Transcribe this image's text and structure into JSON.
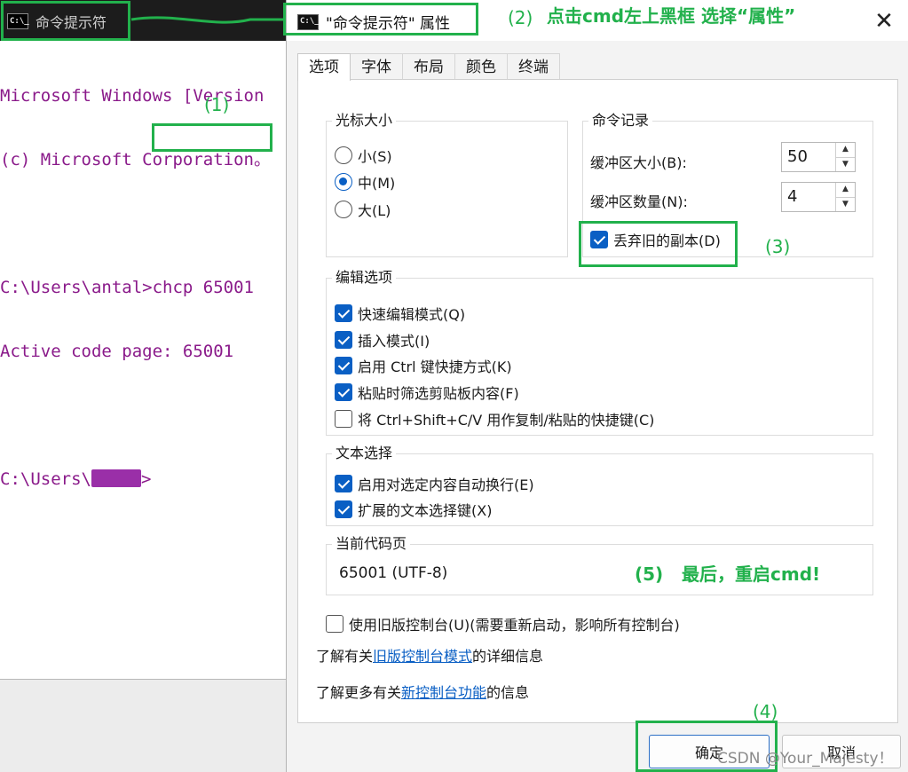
{
  "console": {
    "title": "命令提示符",
    "icon_text": "C:\\_",
    "lines": [
      "Microsoft Windows [Version",
      "(c) Microsoft Corporation。",
      "",
      "C:\\Users\\antal>chcp 65001",
      "Active code page: 65001",
      "",
      "C:\\Users\\"
    ],
    "prompt_suffix": ">"
  },
  "dialog": {
    "title": "\"命令提示符\" 属性",
    "close_glyph": "✕",
    "tabs": [
      "选项",
      "字体",
      "布局",
      "颜色",
      "终端"
    ],
    "active_tab": "选项",
    "cursor_size": {
      "title": "光标大小",
      "options": [
        "小(S)",
        "中(M)",
        "大(L)"
      ],
      "selected": "中(M)"
    },
    "history": {
      "title": "命令记录",
      "buffer_size_label": "缓冲区大小(B):",
      "buffer_size_value": "50",
      "buffer_count_label": "缓冲区数量(N):",
      "buffer_count_value": "4",
      "discard_label": "丢弃旧的副本(D)",
      "discard_checked": true
    },
    "edit_options": {
      "title": "编辑选项",
      "items": [
        {
          "label": "快速编辑模式(Q)",
          "checked": true
        },
        {
          "label": "插入模式(I)",
          "checked": true
        },
        {
          "label": "启用 Ctrl 键快捷方式(K)",
          "checked": true
        },
        {
          "label": "粘贴时筛选剪贴板内容(F)",
          "checked": true
        },
        {
          "label": "将 Ctrl+Shift+C/V 用作复制/粘贴的快捷键(C)",
          "checked": false
        }
      ]
    },
    "text_selection": {
      "title": "文本选择",
      "items": [
        {
          "label": "启用对选定内容自动换行(E)",
          "checked": true
        },
        {
          "label": "扩展的文本选择键(X)",
          "checked": true
        }
      ]
    },
    "codepage": {
      "title": "当前代码页",
      "value": "65001 (UTF-8)"
    },
    "legacy_console": {
      "label": "使用旧版控制台(U)(需要重新启动，影响所有控制台)",
      "checked": false
    },
    "info1": {
      "prefix": "了解有关",
      "link": "旧版控制台模式",
      "suffix": "的详细信息"
    },
    "info2": {
      "prefix": "了解更多有关",
      "link": "新控制台功能",
      "suffix": "的信息"
    },
    "ok_label": "确定",
    "cancel_label": "取消"
  },
  "annotations": {
    "step1": "(1)",
    "step2_num": "(2)",
    "step2_text": "点击cmd左上黑框 选择“属性”",
    "step3": "(3)",
    "step4": "(4)",
    "step5_num": "(5)",
    "step5_text": "最后，重启cmd!",
    "color": "#22b14c"
  },
  "watermark": "CSDN @Your_Majesty！"
}
